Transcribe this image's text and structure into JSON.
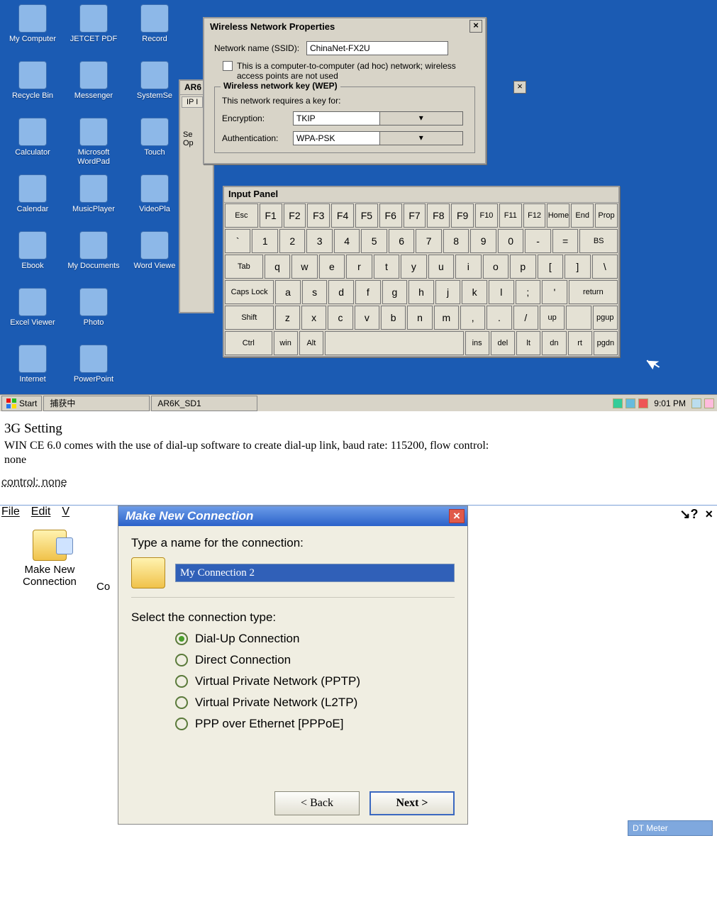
{
  "desktop": {
    "icons": [
      {
        "label": "My Computer"
      },
      {
        "label": "JETCET PDF"
      },
      {
        "label": "Record"
      },
      {
        "label": "Recycle Bin"
      },
      {
        "label": "Messenger"
      },
      {
        "label": "SystemSe"
      },
      {
        "label": "Calculator"
      },
      {
        "label": "Microsoft WordPad"
      },
      {
        "label": "Touch"
      },
      {
        "label": "Calendar"
      },
      {
        "label": "MusicPlayer"
      },
      {
        "label": "VideoPla"
      },
      {
        "label": "Ebook"
      },
      {
        "label": "My Documents"
      },
      {
        "label": "Word Viewe"
      },
      {
        "label": "Excel Viewer"
      },
      {
        "label": "Photo"
      },
      {
        "label": ""
      },
      {
        "label": "Internet"
      },
      {
        "label": "PowerPoint"
      }
    ],
    "bgwin": {
      "title": "AR6",
      "tab": "IP I",
      "line1": "Se",
      "line2": "Op"
    },
    "bgclose": "×"
  },
  "wireless": {
    "title": "Wireless Network Properties",
    "close": "×",
    "ssid_label": "Network name (SSID):",
    "ssid_value": "ChinaNet-FX2U",
    "adhoc_text": "This is a computer-to-computer (ad hoc) network; wireless access points are not used",
    "wep_legend": "Wireless network key (WEP)",
    "requires": "This network requires a key for:",
    "enc_label": "Encryption:",
    "enc_value": "TKIP",
    "auth_label": "Authentication:",
    "auth_value": "WPA-PSK"
  },
  "keyboard": {
    "title": "Input Panel",
    "rows": [
      [
        "Esc",
        "F1",
        "F2",
        "F3",
        "F4",
        "F5",
        "F6",
        "F7",
        "F8",
        "F9",
        "F10",
        "F11",
        "F12",
        "Home",
        "End",
        "Prop"
      ],
      [
        "`",
        "1",
        "2",
        "3",
        "4",
        "5",
        "6",
        "7",
        "8",
        "9",
        "0",
        "-",
        "=",
        "BS"
      ],
      [
        "Tab",
        "q",
        "w",
        "e",
        "r",
        "t",
        "y",
        "u",
        "i",
        "o",
        "p",
        "[",
        "]",
        "\\"
      ],
      [
        "Caps Lock",
        "a",
        "s",
        "d",
        "f",
        "g",
        "h",
        "j",
        "k",
        "l",
        ";",
        "'",
        "return"
      ],
      [
        "Shift",
        "z",
        "x",
        "c",
        "v",
        "b",
        "n",
        "m",
        ",",
        ".",
        "/",
        "up",
        "",
        "pgup"
      ],
      [
        "Ctrl",
        "win",
        "Alt",
        " ",
        "ins",
        "del",
        "lt",
        "dn",
        "rt",
        "pgdn"
      ]
    ]
  },
  "taskbar": {
    "start": "Start",
    "task1": "捕获中",
    "task2": "AR6K_SD1",
    "clock": "9:01 PM"
  },
  "doc": {
    "heading": "3G Setting",
    "line1": "WIN CE 6.0 comes with the use of dial-up software to create dial-up link, baud rate: 115200, flow control:",
    "line2": "none",
    "control_none": "control: none"
  },
  "conn": {
    "menu": {
      "file": "File",
      "edit": "Edit",
      "view": "V"
    },
    "help": "?",
    "close": "×",
    "icon_label1": "Make New",
    "icon_label2": "Connection",
    "co": "Co",
    "wiz_title": "Make New Connection",
    "wiz_close": "×",
    "prompt": "Type a name for the connection:",
    "name_value": "My Connection 2",
    "prompt2": "Select the connection type:",
    "options": [
      {
        "label": "Dial-Up Connection",
        "selected": true
      },
      {
        "label": "Direct Connection",
        "selected": false
      },
      {
        "label": "Virtual Private Network (PPTP)",
        "selected": false
      },
      {
        "label": "Virtual Private Network (L2TP)",
        "selected": false
      },
      {
        "label": "PPP over Ethernet [PPPoE]",
        "selected": false
      }
    ],
    "back": "< Back",
    "next": "Next >",
    "dtmeter": "DT Meter"
  }
}
